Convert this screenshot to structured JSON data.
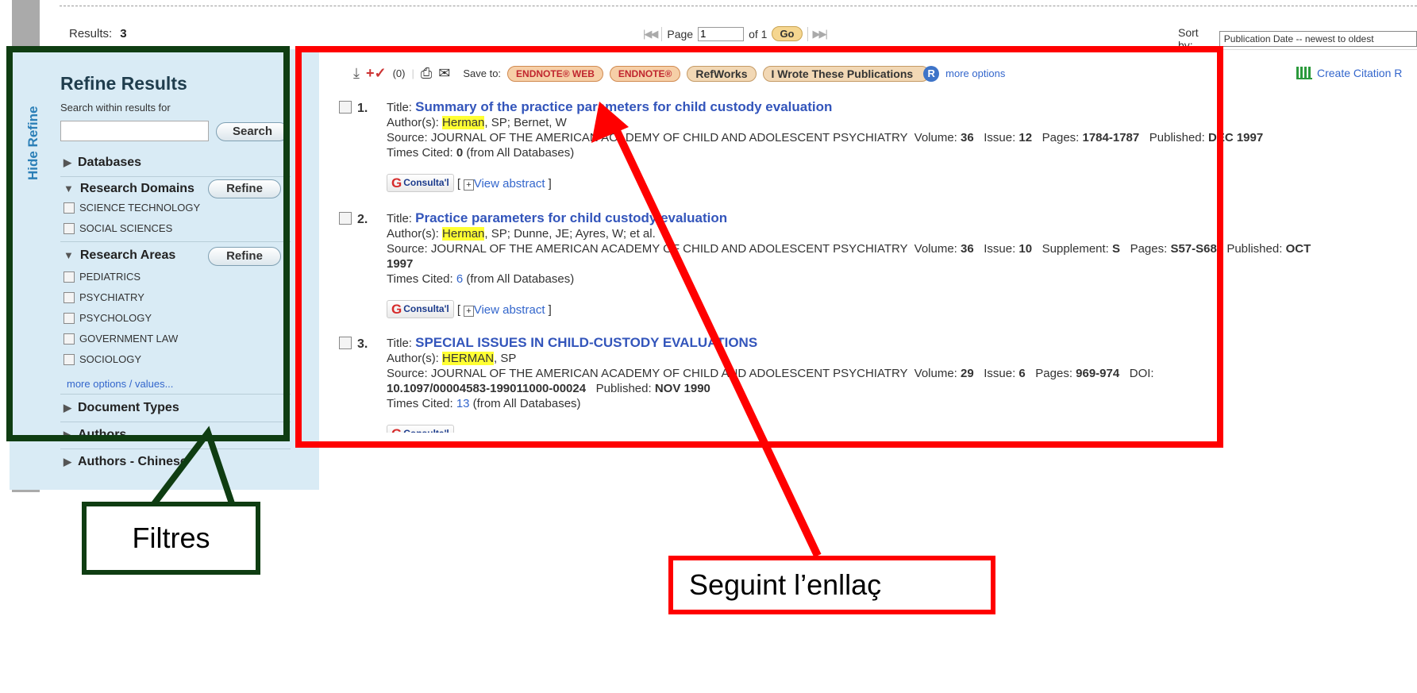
{
  "top": {
    "results_label": "Results:",
    "results_count": "3",
    "page_label": "Page",
    "page_value": "1",
    "page_of": "of 1",
    "go_label": "Go",
    "sort_by_label": "Sort by:",
    "sort_value": "Publication Date -- newest to oldest"
  },
  "sidebar": {
    "hide_tab": "Hide Refine",
    "title": "Refine Results",
    "search_within": "Search within results for",
    "search_button": "Search",
    "databases": "Databases",
    "research_domains": "Research Domains",
    "refine_button": "Refine",
    "domains": [
      "SCIENCE TECHNOLOGY",
      "SOCIAL SCIENCES"
    ],
    "research_areas": "Research Areas",
    "areas": [
      "PEDIATRICS",
      "PSYCHIATRY",
      "PSYCHOLOGY",
      "GOVERNMENT LAW",
      "SOCIOLOGY"
    ],
    "more_options": "more options / values...",
    "document_types": "Document Types",
    "authors": "Authors",
    "authors_chinese": "Authors - Chinese"
  },
  "toolbar": {
    "marked_count": "(0)",
    "save_to": "Save to:",
    "endnote_web": "ENDNOTE® WEB",
    "endnote": "ENDNOTE®",
    "refworks": "RefWorks",
    "i_wrote": "I Wrote These Publications",
    "r_badge": "R",
    "more_options": "more options",
    "create_citation": "Create Citation R"
  },
  "records": [
    {
      "num": "1.",
      "title_label": "Title:",
      "title": "Summary of the practice parameters for child custody evaluation",
      "authors_label": "Author(s):",
      "author_hl": "Herman",
      "authors_rest": ", SP; Bernet, W",
      "source_label": "Source:",
      "source_journal": "JOURNAL OF THE AMERICAN ACADEMY OF CHILD AND ADOLESCENT PSYCHIATRY",
      "volume_label": "Volume:",
      "volume": "36",
      "issue_label": "Issue:",
      "issue": "12",
      "pages_label": "Pages:",
      "pages": "1784-1787",
      "published_label": "Published:",
      "published": "DEC 1997",
      "times_cited_label": "Times Cited:",
      "times_cited": "0",
      "from_all": "(from All Databases)"
    },
    {
      "num": "2.",
      "title_label": "Title:",
      "title": "Practice parameters for child custody evaluation",
      "authors_label": "Author(s):",
      "author_hl": "Herman",
      "authors_rest": ", SP; Dunne, JE; Ayres, W; et al.",
      "source_label": "Source:",
      "source_journal": "JOURNAL OF THE AMERICAN ACADEMY OF CHILD AND ADOLESCENT PSYCHIATRY",
      "volume_label": "Volume:",
      "volume": "36",
      "issue_label": "Issue:",
      "issue": "10",
      "supplement_label": "Supplement:",
      "supplement": "S",
      "pages_label": "Pages:",
      "pages": "S57-S68",
      "published_label": "Published:",
      "published_oct": "OCT",
      "published_year": "1997",
      "times_cited_label": "Times Cited:",
      "times_cited": "6",
      "from_all": "(from All Databases)"
    },
    {
      "num": "3.",
      "title_label": "Title:",
      "title": "SPECIAL ISSUES IN CHILD-CUSTODY EVALUATIONS",
      "authors_label": "Author(s):",
      "author_hl": "HERMAN",
      "authors_rest": ", SP",
      "source_label": "Source:",
      "source_journal": "JOURNAL OF THE AMERICAN ACADEMY OF CHILD AND ADOLESCENT PSYCHIATRY",
      "volume_label": "Volume:",
      "volume": "29",
      "issue_label": "Issue:",
      "issue": "6",
      "pages_label": "Pages:",
      "pages": "969-974",
      "doi_label": "DOI:",
      "doi": "10.1097/00004583-199011000-00024",
      "published_label": "Published:",
      "published": "NOV 1990",
      "times_cited_label": "Times Cited:",
      "times_cited": "13",
      "from_all": "(from All Databases)"
    }
  ],
  "consulta_label": "Consulta'l",
  "view_abstract": "View abstract",
  "annotations": {
    "filtres": "Filtres",
    "seguint": "Seguint l’enllaç"
  },
  "colors": {
    "green_annotation": "#0f3d12",
    "red_annotation": "#ff0000",
    "sidebar_bg": "#d9ebf5",
    "link_blue": "#3355bb"
  }
}
